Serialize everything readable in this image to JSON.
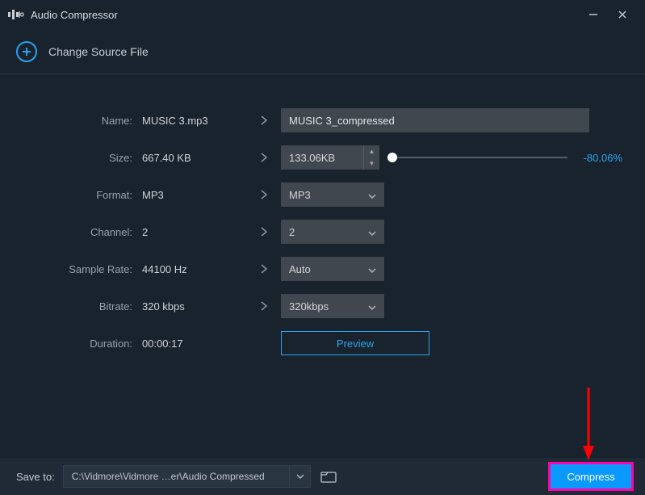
{
  "titlebar": {
    "app_title": "Audio Compressor"
  },
  "source": {
    "change_label": "Change Source File"
  },
  "labels": {
    "name": "Name:",
    "size": "Size:",
    "format": "Format:",
    "channel": "Channel:",
    "sample_rate": "Sample Rate:",
    "bitrate": "Bitrate:",
    "duration": "Duration:"
  },
  "values": {
    "name": "MUSIC 3.mp3",
    "size": "667.40 KB",
    "format": "MP3",
    "channel": "2",
    "sample_rate": "44100 Hz",
    "bitrate": "320 kbps",
    "duration": "00:00:17"
  },
  "controls": {
    "name_input": "MUSIC 3_compressed",
    "size_spinner": "133.06KB",
    "size_percent": "-80.06%",
    "format_select": "MP3",
    "channel_select": "2",
    "sample_rate_select": "Auto",
    "bitrate_select": "320kbps",
    "preview_label": "Preview"
  },
  "footer": {
    "saveto_label": "Save to:",
    "path": "C:\\Vidmore\\Vidmore …er\\Audio Compressed",
    "compress_label": "Compress"
  }
}
